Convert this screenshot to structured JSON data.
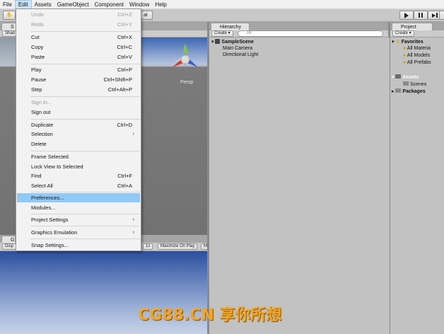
{
  "menubar": {
    "items": [
      "File",
      "Edit",
      "Assets",
      "GameObject",
      "Component",
      "Window",
      "Help"
    ]
  },
  "toolbar": {
    "global_fragment": "al"
  },
  "scene": {
    "tab_fragment": "S",
    "sub_fragment": "Shad",
    "persp_label": "Persp"
  },
  "game": {
    "tab_fragment": "G",
    "sub_fragment": "Disp",
    "scale_fragment": "1x",
    "maximize_label": "Maximize On Play",
    "mute_fragment": "M"
  },
  "hierarchy": {
    "tab_label": "Hierarchy",
    "create_label": "Create",
    "search_placeholder": "All",
    "scene_name": "SampleScene",
    "children": [
      "Main Camera",
      "Directional Light"
    ]
  },
  "project": {
    "tab_label": "Project",
    "create_label": "Create",
    "favorites_label": "Favorites",
    "favorites": [
      "All Materia",
      "All Models",
      "All Prefabs"
    ],
    "assets_label": "Assets",
    "scenes_label": "Scenes",
    "packages_label": "Packages"
  },
  "edit_menu": {
    "items": [
      {
        "label": "Undo",
        "shortcut": "Ctrl+Z",
        "disabled": true
      },
      {
        "label": "Redo",
        "shortcut": "Ctrl+Y",
        "disabled": true
      },
      {
        "label": "Cut",
        "shortcut": "Ctrl+X"
      },
      {
        "label": "Copy",
        "shortcut": "Ctrl+C"
      },
      {
        "label": "Paste",
        "shortcut": "Ctrl+V"
      },
      {
        "label": "Play",
        "shortcut": "Ctrl+P"
      },
      {
        "label": "Pause",
        "shortcut": "Ctrl+Shift+P"
      },
      {
        "label": "Step",
        "shortcut": "Ctrl+Alt+P"
      },
      {
        "label": "Sign in...",
        "shortcut": "",
        "disabled": true
      },
      {
        "label": "Sign out",
        "shortcut": ""
      },
      {
        "label": "Duplicate",
        "shortcut": "Ctrl+D"
      },
      {
        "label": "Selection",
        "shortcut": "",
        "submenu": true
      },
      {
        "label": "Delete",
        "shortcut": ""
      },
      {
        "label": "Frame Selected",
        "shortcut": ""
      },
      {
        "label": "Lock View to Selected",
        "shortcut": ""
      },
      {
        "label": "Find",
        "shortcut": "Ctrl+F"
      },
      {
        "label": "Select All",
        "shortcut": "Ctrl+A"
      },
      {
        "label": "Preferences...",
        "shortcut": "",
        "highlighted": true
      },
      {
        "label": "Modules...",
        "shortcut": ""
      },
      {
        "label": "Project Settings",
        "shortcut": "",
        "submenu": true
      },
      {
        "label": "Graphics Emulation",
        "shortcut": "",
        "submenu": true
      },
      {
        "label": "Snap Settings...",
        "shortcut": ""
      }
    ]
  },
  "watermark": {
    "text": "CG88.CN 享你所想"
  },
  "colors": {
    "menu_highlight": "#91c9f7",
    "watermark": "#f5a623"
  }
}
